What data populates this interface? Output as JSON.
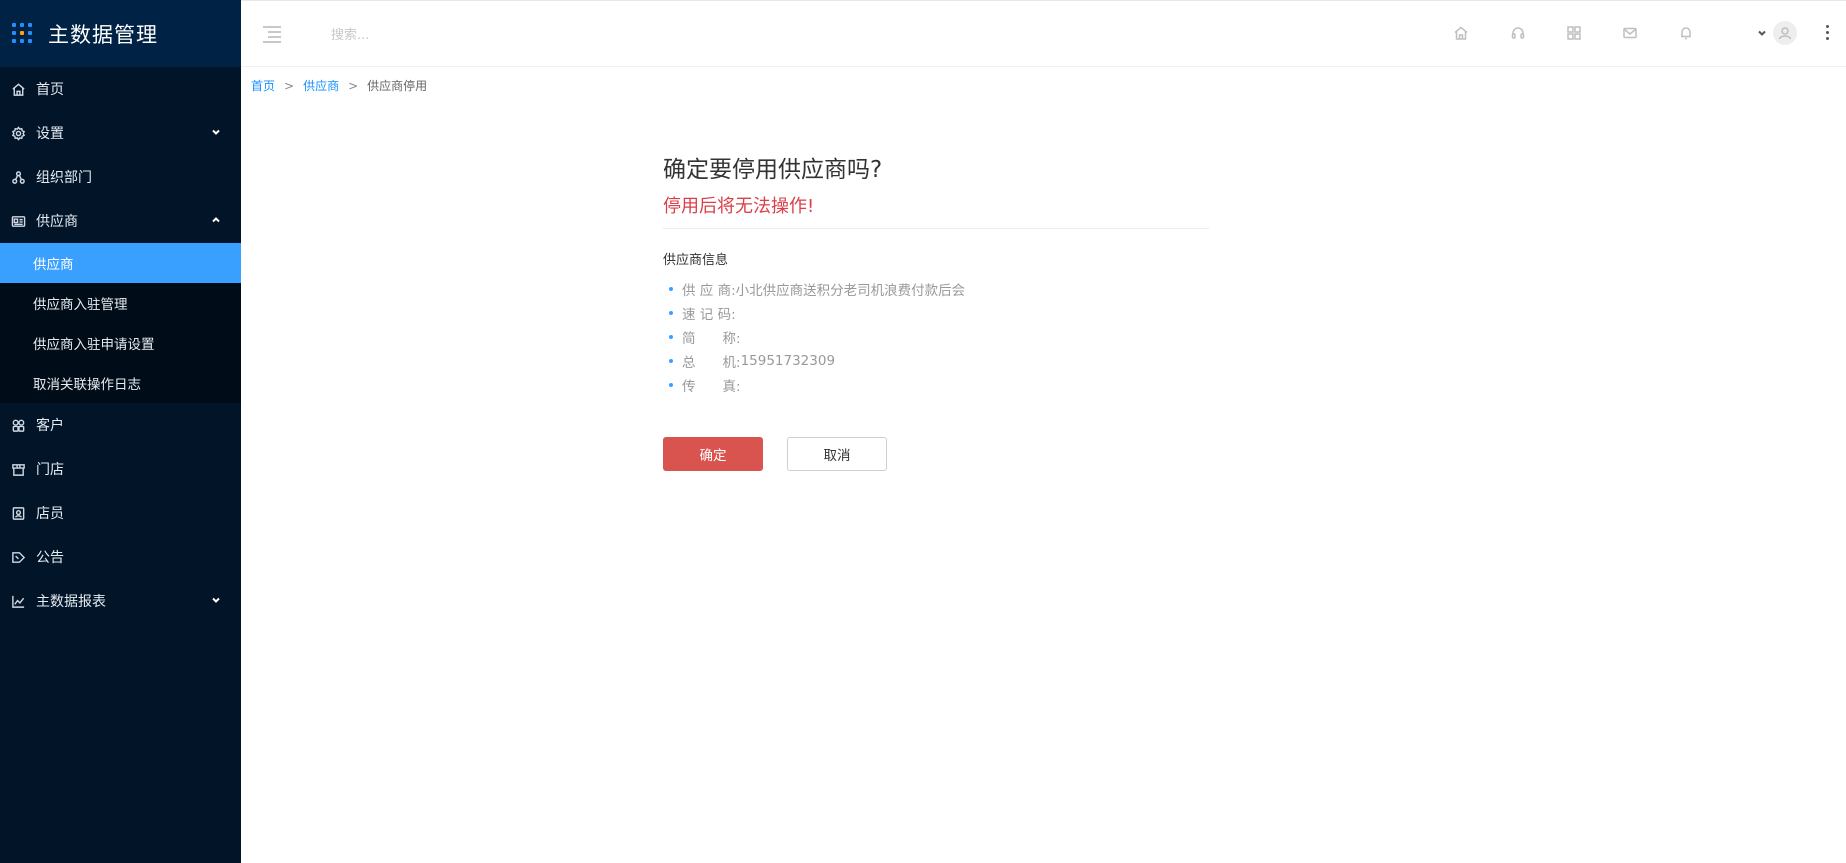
{
  "app": {
    "title": "主数据管理"
  },
  "sidebar": {
    "items": [
      {
        "label": "首页",
        "icon": "home-icon"
      },
      {
        "label": "设置",
        "icon": "gear-icon",
        "expandable": true
      },
      {
        "label": "组织部门",
        "icon": "org-icon"
      },
      {
        "label": "供应商",
        "icon": "id-card-icon",
        "expanded": true,
        "children": [
          "供应商",
          "供应商入驻管理",
          "供应商入驻申请设置",
          "取消关联操作日志"
        ]
      },
      {
        "label": "客户",
        "icon": "customer-icon"
      },
      {
        "label": "门店",
        "icon": "store-icon"
      },
      {
        "label": "店员",
        "icon": "clerk-icon"
      },
      {
        "label": "公告",
        "icon": "announcement-icon"
      },
      {
        "label": "主数据报表",
        "icon": "chart-icon",
        "expandable": true
      }
    ],
    "active_child": "供应商"
  },
  "header": {
    "search_placeholder": "搜索...",
    "icons": [
      "home-icon",
      "headset-icon",
      "apps-icon",
      "mail-icon",
      "bell-icon"
    ]
  },
  "breadcrumb": {
    "home": "首页",
    "parent": "供应商",
    "current": "供应商停用"
  },
  "dialog": {
    "title": "确定要停用供应商吗?",
    "warning": "停用后将无法操作!",
    "info_title": "供应商信息",
    "fields": [
      {
        "label": "供 应 商:",
        "value": "小北供应商送积分老司机浪费付款后会"
      },
      {
        "label": "速 记 码:",
        "value": ""
      },
      {
        "label": "简　　称:",
        "value": ""
      },
      {
        "label": "总　　机:",
        "value": "15951732309"
      },
      {
        "label": "传　　真:",
        "value": ""
      }
    ],
    "confirm_label": "确定",
    "cancel_label": "取消"
  },
  "colors": {
    "sidebar_bg": "#011428",
    "active": "#3aa0ff",
    "danger": "#d9534f",
    "warning_text": "#d9404a",
    "link": "#1890ff"
  }
}
